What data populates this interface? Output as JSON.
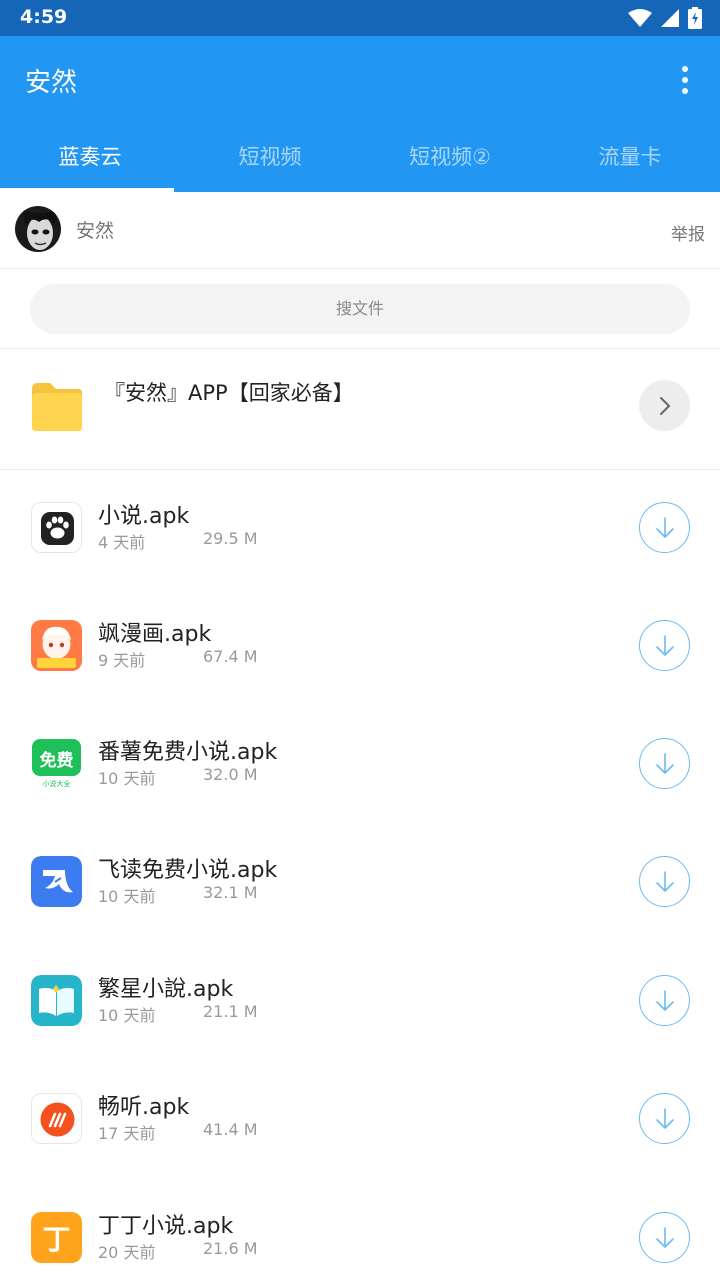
{
  "status": {
    "time": "4:59"
  },
  "appbar": {
    "title": "安然"
  },
  "tabs": [
    {
      "label": "蓝奏云",
      "active": true
    },
    {
      "label": "短视频"
    },
    {
      "label": "短视频②"
    },
    {
      "label": "流量卡"
    }
  ],
  "profile": {
    "name": "安然",
    "report_label": "举报"
  },
  "search": {
    "placeholder": "搜文件"
  },
  "folder": {
    "name": "『安然』APP【回家必备】"
  },
  "files": [
    {
      "name": "小说.apk",
      "age": "4 天前",
      "size": "29.5 M",
      "icon": "paw-icon"
    },
    {
      "name": "飒漫画.apk",
      "age": "9 天前",
      "size": "67.4 M",
      "icon": "anime-girl-icon"
    },
    {
      "name": "番薯免费小说.apk",
      "age": "10 天前",
      "size": "32.0 M",
      "icon": "free-novel-icon"
    },
    {
      "name": "飞读免费小说.apk",
      "age": "10 天前",
      "size": "32.1 M",
      "icon": "feidu-icon"
    },
    {
      "name": "繁星小說.apk",
      "age": "10 天前",
      "size": "21.1 M",
      "icon": "open-book-icon"
    },
    {
      "name": "畅听.apk",
      "age": "17 天前",
      "size": "41.4 M",
      "icon": "audio-icon"
    },
    {
      "name": "丁丁小说.apk",
      "age": "20 天前",
      "size": "21.6 M",
      "icon": "dingding-icon"
    }
  ],
  "icon_badges": {
    "free": "免费",
    "novel_suite": "小说大全",
    "manga": "飒漫画",
    "ding": "丁"
  },
  "colors": {
    "status_bar": "#1565b8",
    "app_bar": "#2196f3",
    "download_accent": "#6bbbee",
    "folder": "#ffd54f"
  }
}
